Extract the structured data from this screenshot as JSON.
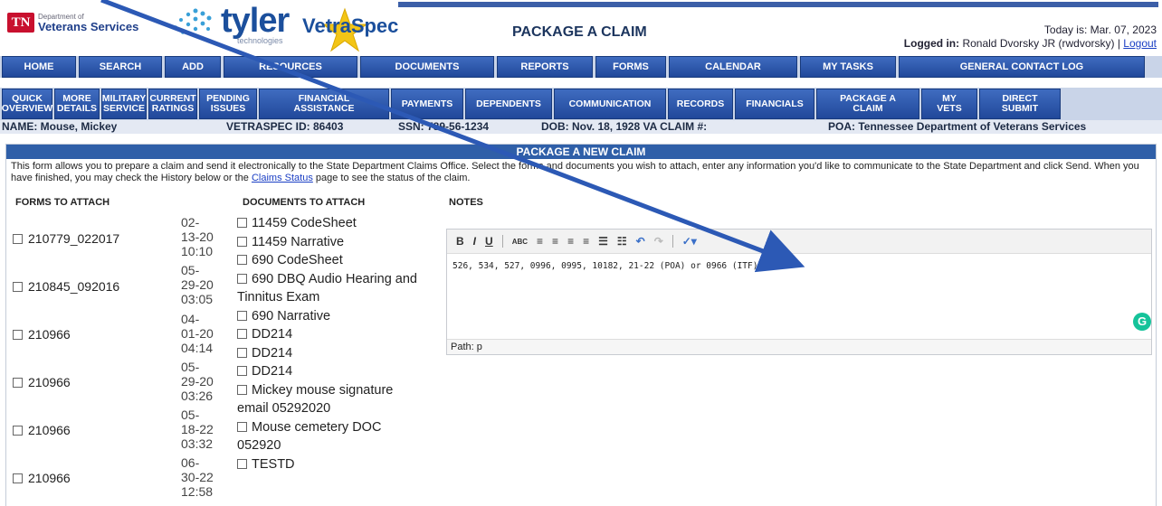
{
  "header": {
    "badge": "TN",
    "dept_small": "Department of",
    "dept_name": "Veterans Services",
    "brand_main": "tyler",
    "brand_sub": "technologies",
    "product": "VetraSpec",
    "page_title": "PACKAGE A CLAIM",
    "today_label": "Today is: Mar. 07, 2023",
    "logged_label": "Logged in:",
    "logged_user": "Ronald Dvorsky JR (rwdvorsky)",
    "separator": "|",
    "logout": "Logout"
  },
  "nav_primary": [
    "HOME",
    "SEARCH",
    "ADD",
    "RESOURCES",
    "DOCUMENTS",
    "REPORTS",
    "FORMS",
    "CALENDAR",
    "MY TASKS",
    "GENERAL CONTACT LOG"
  ],
  "nav_secondary": [
    "QUICK\nOVERVIEW",
    "MORE\nDETAILS",
    "MILITARY\nSERVICE",
    "CURRENT\nRATINGS",
    "PENDING\nISSUES",
    "FINANCIAL\nASSISTANCE",
    "PAYMENTS",
    "DEPENDENTS",
    "COMMUNICATION",
    "RECORDS",
    "FINANCIALS",
    "PACKAGE A\nCLAIM",
    "MY\nVETS",
    "DIRECT\nSUBMIT"
  ],
  "patient": {
    "name": "NAME:  Mouse, Mickey",
    "vetraspec_id": "VETRASPEC ID: 86403",
    "ssn": "SSN:  789-56-1234",
    "dob": "DOB: Nov. 18, 1928 VA CLAIM #:",
    "poa": "POA: Tennessee Department of Veterans Services"
  },
  "panel": {
    "title": "PACKAGE A NEW CLAIM",
    "description_1": "This form allows you to prepare a claim and send it electronically to the State Department Claims Office. Select the forms and documents you wish to attach, enter any information you'd like to communicate to the State Department and click Send. When you have finished, you may check the History below or the ",
    "claims_status_link": "Claims Status",
    "description_2": " page to see the status of the claim.",
    "forms_header": "FORMS TO ATTACH",
    "docs_header": "DOCUMENTS TO ATTACH",
    "notes_header": "NOTES"
  },
  "forms": [
    {
      "name": "210779_022017",
      "date": "02-\n13-20\n10:10"
    },
    {
      "name": "210845_092016",
      "date": "05-\n29-20\n03:05"
    },
    {
      "name": "210966",
      "date": "04-\n01-20\n04:14"
    },
    {
      "name": "210966",
      "date": "05-\n29-20\n03:26"
    },
    {
      "name": "210966",
      "date": "05-\n18-22\n03:32"
    },
    {
      "name": "210966",
      "date": "06-\n30-22\n12:58"
    }
  ],
  "documents": [
    "11459 CodeSheet",
    "11459 Narrative",
    "690 CodeSheet",
    "690 DBQ Audio Hearing and Tinnitus Exam",
    "690 Narrative",
    "DD214",
    "DD214",
    "DD214",
    "Mickey mouse signature email 05292020",
    "Mouse cemetery DOC 052920",
    "TESTD"
  ],
  "editor": {
    "content": "526, 534, 527, 0996, 0995, 10182, 21-22 (POA) or 0966 (ITF)",
    "path": "Path: p",
    "bold": "B",
    "italic": "I",
    "underline": "U",
    "spell": "ABC"
  },
  "colors": {
    "nav_blue": "#2f5fa8",
    "nav_bg": "#c9d4e8",
    "accent_green": "#15c39a",
    "brand_blue": "#1b4f9c"
  }
}
